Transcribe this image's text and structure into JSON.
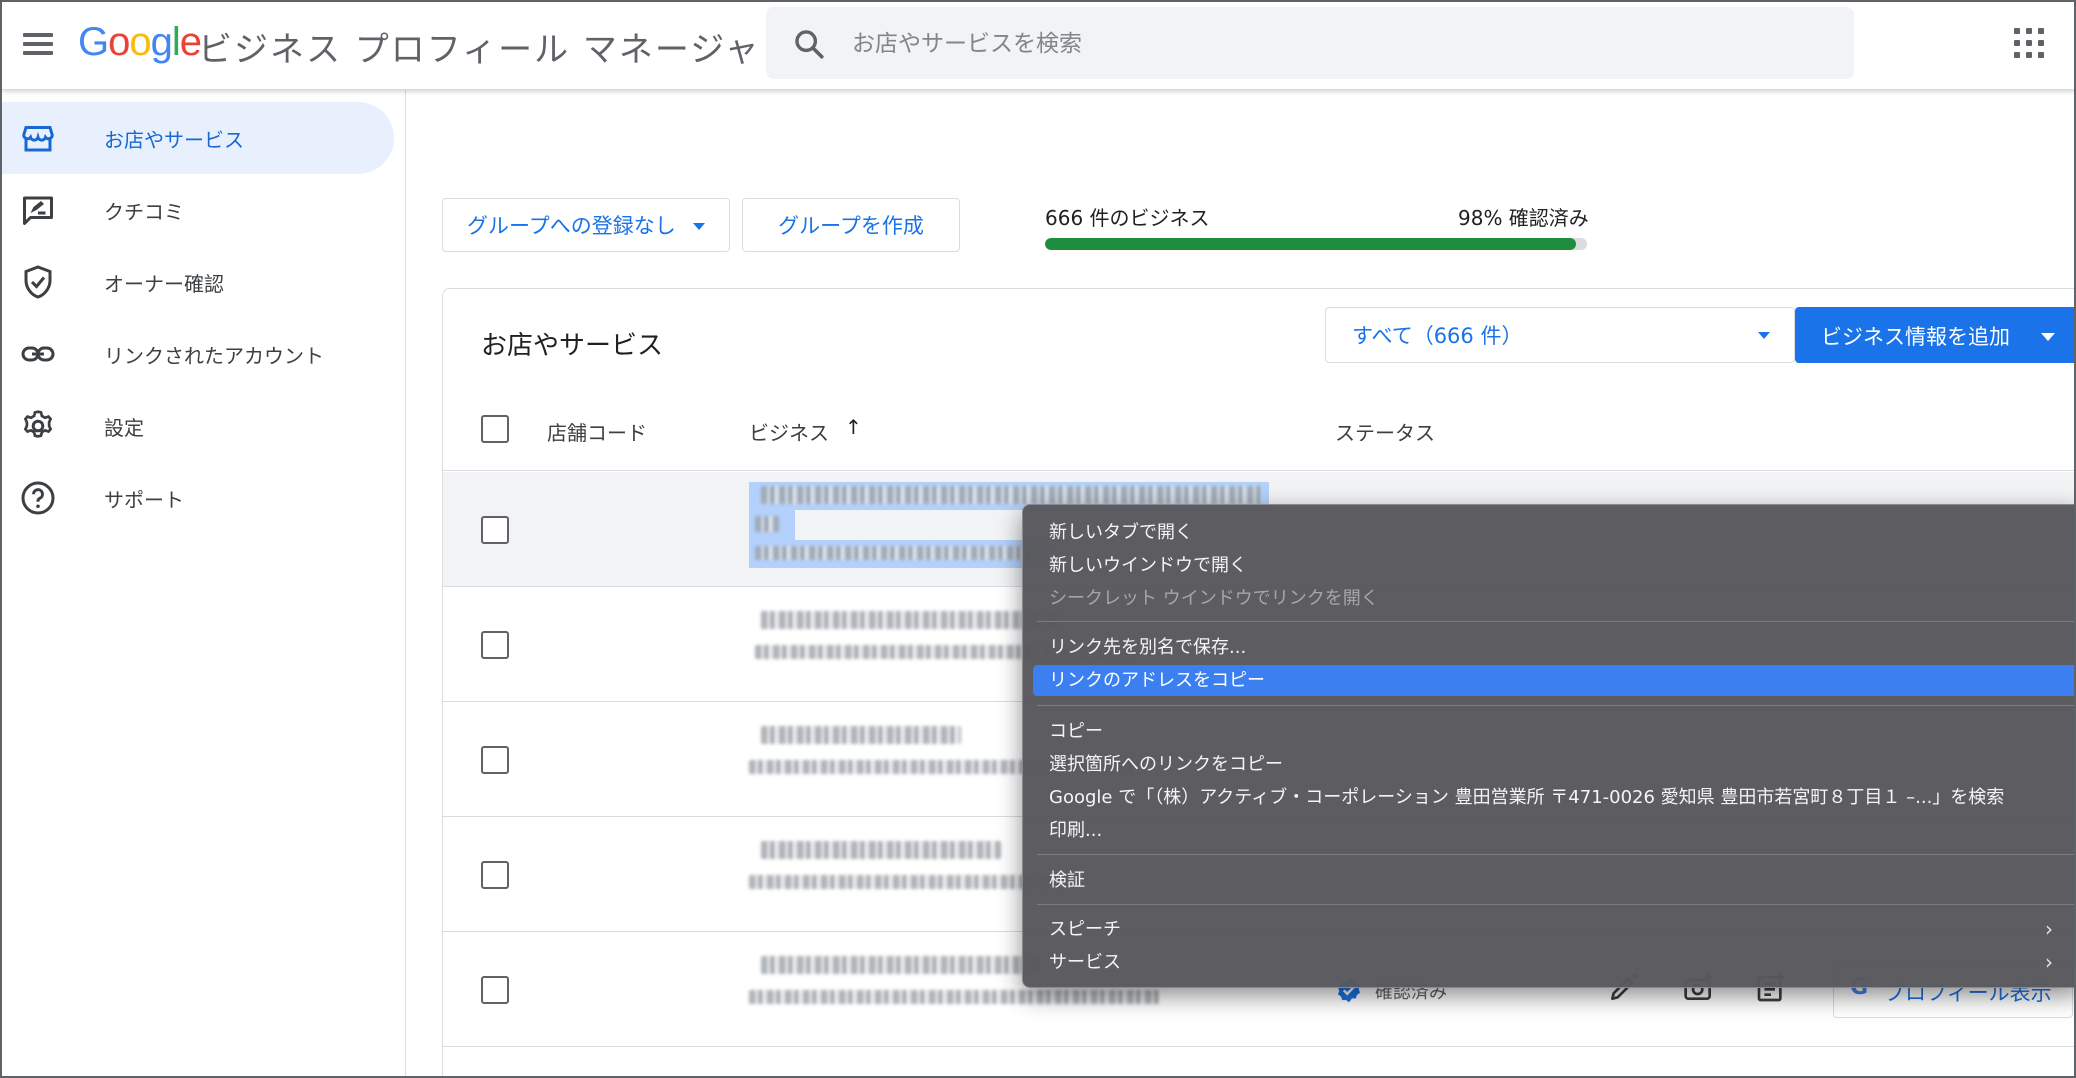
{
  "header": {
    "logo": [
      {
        "ch": "G",
        "color": "#4285f4"
      },
      {
        "ch": "o",
        "color": "#ea4335"
      },
      {
        "ch": "o",
        "color": "#fbbc05"
      },
      {
        "ch": "g",
        "color": "#4285f4"
      },
      {
        "ch": "l",
        "color": "#34a853"
      },
      {
        "ch": "e",
        "color": "#ea4335"
      }
    ],
    "title": "ビジネス プロフィール マネージャ",
    "search_placeholder": "お店やサービスを検索"
  },
  "sidebar": {
    "items": [
      {
        "label": "お店やサービス",
        "icon": "storefront-icon",
        "active": true
      },
      {
        "label": "クチコミ",
        "icon": "review-icon",
        "active": false
      },
      {
        "label": "オーナー確認",
        "icon": "shield-check-icon",
        "active": false
      },
      {
        "label": "リンクされたアカウント",
        "icon": "link-icon",
        "active": false
      },
      {
        "label": "設定",
        "icon": "gear-icon",
        "active": false
      },
      {
        "label": "サポート",
        "icon": "help-icon",
        "active": false
      }
    ]
  },
  "toolbar": {
    "group_dropdown": "グループへの登録なし",
    "create_group": "グループを作成",
    "business_count": "666 件のビジネス",
    "verified_label": "98% 確認済み",
    "verified_progress": 0.98
  },
  "card": {
    "title": "お店やサービス",
    "filter": "すべて（666 件）",
    "add_button": "ビジネス情報を追加",
    "columns": {
      "code": "店舗コード",
      "business": "ビジネス",
      "status": "ステータス"
    }
  },
  "rows": [
    {
      "status": ""
    },
    {
      "status": ""
    },
    {
      "status": ""
    },
    {
      "status": ""
    },
    {
      "status": "確認済み"
    }
  ],
  "profile_button": "プロフィール表示",
  "context_menu": {
    "items": [
      {
        "label": "新しいタブで開く"
      },
      {
        "label": "新しいウインドウで開く"
      },
      {
        "label": "シークレット ウインドウでリンクを開く",
        "disabled": true
      },
      {
        "label": "リンク先を別名で保存..."
      },
      {
        "label": "リンクのアドレスをコピー",
        "highlighted": true
      },
      {
        "label": "コピー"
      },
      {
        "label": "選択箇所へのリンクをコピー"
      },
      {
        "label": "Google で「（株）アクティブ・コーポレーション 豊田営業所 〒471-0026 愛知県 豊田市若宮町８丁目１ –...」を検索"
      },
      {
        "label": "印刷..."
      },
      {
        "label": "検証"
      },
      {
        "label": "スピーチ",
        "submenu": true
      },
      {
        "label": "サービス",
        "submenu": true
      }
    ]
  },
  "colors": {
    "accent": "#1a73e8",
    "progress": "#1e8e3e",
    "menu_highlight": "#3b7ff0"
  }
}
